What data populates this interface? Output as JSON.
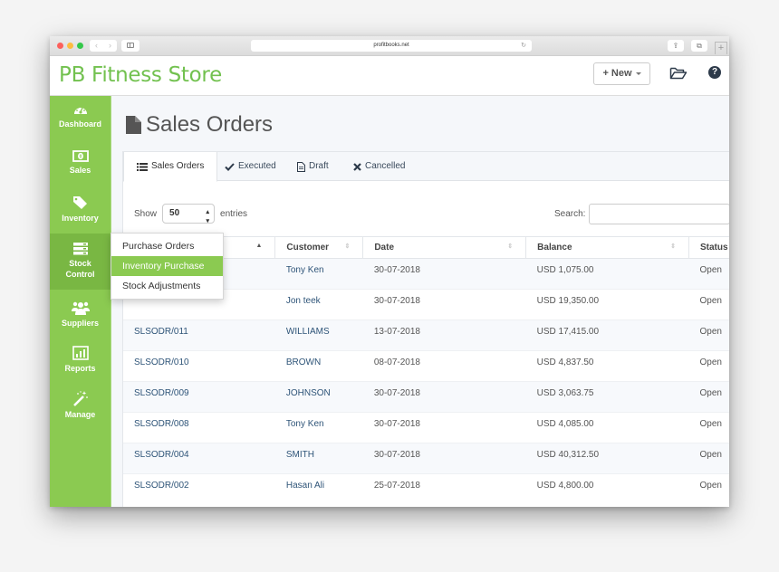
{
  "browser": {
    "url": "profitbooks.net",
    "back_glyph": "‹",
    "forward_glyph": "›",
    "reload_glyph": "↻",
    "share_glyph": "⇪",
    "tabs_glyph": "⧉",
    "newtab_glyph": "+"
  },
  "header": {
    "brand": "PB Fitness Store",
    "new_button_label": "+ New",
    "help_glyph": "?"
  },
  "colors": {
    "brand_green": "#72c14f",
    "sidebar_green": "#8bca51",
    "sidebar_active": "#79b743",
    "link_blue": "#2e5478"
  },
  "sidebar": {
    "items": [
      {
        "label": "Dashboard",
        "icon": "dashboard-gauge-icon"
      },
      {
        "label": "Sales",
        "icon": "money-icon"
      },
      {
        "label": "Inventory",
        "icon": "tag-icon"
      },
      {
        "label_line1": "Stock",
        "label_line2": "Control",
        "icon": "server-stack-icon",
        "active": true
      },
      {
        "label": "Suppliers",
        "icon": "users-icon"
      },
      {
        "label": "Reports",
        "icon": "bar-chart-icon"
      },
      {
        "label": "Manage",
        "icon": "magic-wand-icon"
      }
    ]
  },
  "dropdown": {
    "items": [
      {
        "label": "Purchase Orders"
      },
      {
        "label": "Inventory Purchase",
        "active": true
      },
      {
        "label": "Stock Adjustments"
      }
    ]
  },
  "page": {
    "title": "Sales Orders",
    "tabs": [
      {
        "label": "Sales Orders",
        "icon": "list-icon",
        "active": true
      },
      {
        "label": "Executed",
        "icon": "check-icon"
      },
      {
        "label": "Draft",
        "icon": "file-text-icon"
      },
      {
        "label": "Cancelled",
        "icon": "times-icon"
      }
    ],
    "show_label": "Show",
    "entries_value": "50",
    "entries_label": "entries",
    "search_label": "Search:",
    "search_value": ""
  },
  "table": {
    "columns": [
      "",
      "Customer",
      "Date",
      "Balance",
      "Status"
    ],
    "rows": [
      {
        "order": "",
        "customer": "Tony Ken",
        "date": "30-07-2018",
        "balance": "USD 1,075.00",
        "status": "Open"
      },
      {
        "order": "",
        "customer": "Jon teek",
        "date": "30-07-2018",
        "balance": "USD 19,350.00",
        "status": "Open"
      },
      {
        "order": "SLSODR/011",
        "customer": "WILLIAMS",
        "date": "13-07-2018",
        "balance": "USD 17,415.00",
        "status": "Open"
      },
      {
        "order": "SLSODR/010",
        "customer": "BROWN",
        "date": "08-07-2018",
        "balance": "USD 4,837.50",
        "status": "Open"
      },
      {
        "order": "SLSODR/009",
        "customer": "JOHNSON",
        "date": "30-07-2018",
        "balance": "USD 3,063.75",
        "status": "Open"
      },
      {
        "order": "SLSODR/008",
        "customer": "Tony Ken",
        "date": "30-07-2018",
        "balance": "USD 4,085.00",
        "status": "Open"
      },
      {
        "order": "SLSODR/004",
        "customer": "SMITH",
        "date": "30-07-2018",
        "balance": "USD 40,312.50",
        "status": "Open"
      },
      {
        "order": "SLSODR/002",
        "customer": "Hasan Ali",
        "date": "25-07-2018",
        "balance": "USD 4,800.00",
        "status": "Open"
      }
    ]
  }
}
